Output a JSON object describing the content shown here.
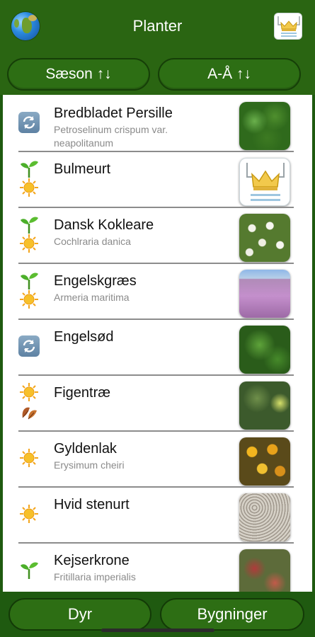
{
  "header": {
    "title": "Planter",
    "left_icon": "globe-icon",
    "right_icon": "royal-crown-icon"
  },
  "sort": {
    "season_label": "Sæson ↑↓",
    "alpha_label": "A-Å ↑↓"
  },
  "plants": [
    {
      "name": "Bredbladet Persille",
      "latin": "Petroselinum crispum var. neapolitanum",
      "icons": [
        "sync"
      ],
      "thumb": "parsley"
    },
    {
      "name": "Bulmeurt",
      "latin": "",
      "icons": [
        "sprout",
        "sun"
      ],
      "thumb": "crown"
    },
    {
      "name": "Dansk Kokleare",
      "latin": "Cochlraria danica",
      "icons": [
        "sprout",
        "sun"
      ],
      "thumb": "white-flowers"
    },
    {
      "name": "Engelskgræs",
      "latin": "Armeria maritima",
      "icons": [
        "sprout",
        "sun"
      ],
      "thumb": "pink-flowers"
    },
    {
      "name": "Engelsød",
      "latin": "",
      "icons": [
        "sync"
      ],
      "thumb": "fern"
    },
    {
      "name": "Figentræ",
      "latin": "",
      "icons": [
        "sun",
        "autumn-leaf"
      ],
      "thumb": "fig"
    },
    {
      "name": "Gyldenlak",
      "latin": "Erysimum cheiri",
      "icons": [
        "sun"
      ],
      "thumb": "yellow-flowers"
    },
    {
      "name": "Hvid stenurt",
      "latin": "",
      "icons": [
        "sun"
      ],
      "thumb": "stonecrop"
    },
    {
      "name": "Kejserkrone",
      "latin": "Fritillaria imperialis",
      "icons": [
        "sprout"
      ],
      "thumb": "red-flowers"
    }
  ],
  "footer": {
    "animals_label": "Dyr",
    "buildings_label": "Bygninger"
  },
  "colors": {
    "header_green": "#2a6512",
    "button_green": "#2d6e14",
    "button_border": "#163f08",
    "latin_gray": "#8a8a8a"
  }
}
